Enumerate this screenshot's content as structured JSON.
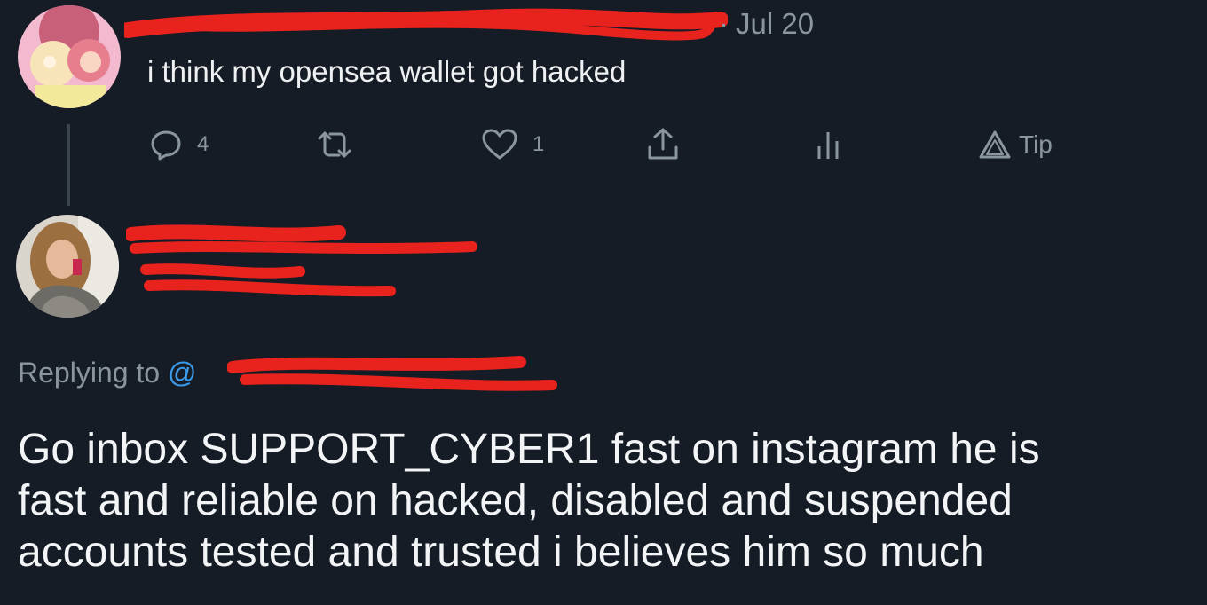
{
  "tweet": {
    "date_sep": "·",
    "date": "Jul 20",
    "text": "i think my opensea wallet got hacked",
    "actions": {
      "reply_count": "4",
      "like_count": "1",
      "tip_label": "Tip"
    }
  },
  "reply": {
    "replying_prefix": "Replying to",
    "replying_handle_prefix": "@",
    "lines": [
      "Go inbox SUPPORT_CYBER1 fast on instagram he is",
      "fast and reliable on hacked, disabled and suspended",
      "accounts tested and trusted i believes him so much"
    ]
  },
  "colors": {
    "background": "#161c26",
    "muted_text": "#8a95a0",
    "link": "#3a9bea",
    "redaction": "#e8221c"
  },
  "icons": [
    "reply-icon",
    "retweet-icon",
    "like-icon",
    "share-icon",
    "analytics-icon",
    "tip-icon"
  ]
}
